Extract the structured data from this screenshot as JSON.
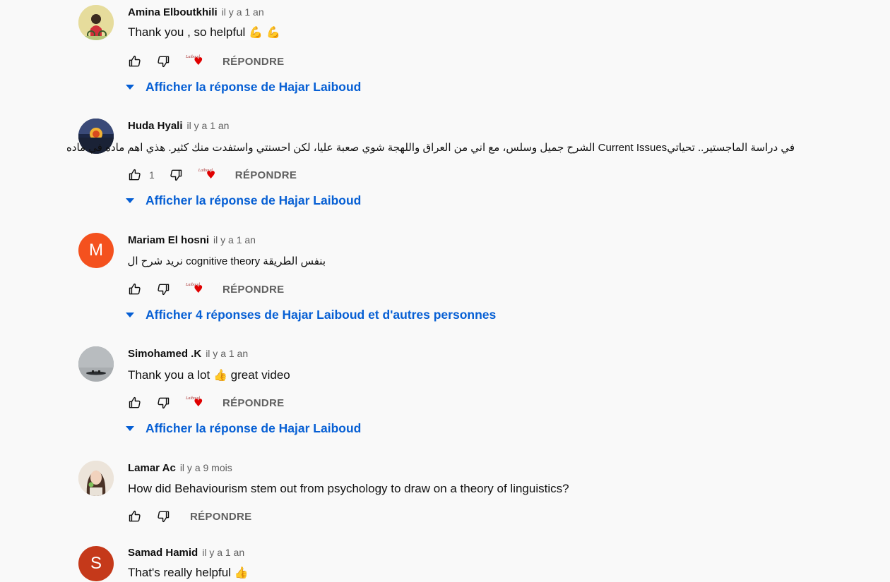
{
  "comments": [
    {
      "author": "Amina Elboutkhili",
      "time": "il y a 1 an",
      "text": "Thank you , so helpful",
      "emoji": "💪 💪",
      "like_count": "",
      "reply_label": "RÉPONDRE",
      "creator_heart_label": "Laiboud",
      "show_replies_label": "Afficher la réponse de Hajar Laiboud"
    },
    {
      "author": "Huda Hyali",
      "time": "il y a 1 an",
      "text": "في دراسة الماجستير.. تحياتيCurrent Issues الشرح جميل وسلس، مع اني من العراق واللهجة شوي صعبة عليا، لكن احسنتي واستفدت منك كثير. هذي اهم ماده في ماده",
      "like_count": "1",
      "reply_label": "RÉPONDRE",
      "creator_heart_label": "Laiboud",
      "show_replies_label": "Afficher la réponse de Hajar Laiboud"
    },
    {
      "author": "Mariam El hosni",
      "time": "il y a 1 an",
      "avatar_letter": "M",
      "text": "بنفس الطريقة cognitive theory نريد شرح ال",
      "like_count": "",
      "reply_label": "RÉPONDRE",
      "creator_heart_label": "Laiboud",
      "show_replies_label": "Afficher 4 réponses de Hajar Laiboud et d'autres personnes"
    },
    {
      "author": "Simohamed .K",
      "time": "il y a 1 an",
      "text_before": "Thank you a lot",
      "emoji": "👍",
      "text_after": "great video",
      "like_count": "",
      "reply_label": "RÉPONDRE",
      "creator_heart_label": "Laiboud",
      "show_replies_label": "Afficher la réponse de Hajar Laiboud"
    },
    {
      "author": "Lamar Ac",
      "time": "il y a 9 mois",
      "text": "How did Behaviourism stem out from psychology to draw on a theory of linguistics?",
      "like_count": "",
      "reply_label": "RÉPONDRE"
    },
    {
      "author": "Samad Hamid",
      "time": "il y a 1 an",
      "avatar_letter": "S",
      "text": "That's really helpful",
      "emoji": "👍"
    }
  ],
  "colors": {
    "link_blue": "#065fd4",
    "meta_gray": "#606060",
    "avatar_orange": "#f4511e",
    "avatar_red": "#c5391a",
    "heart_red": "#e00000"
  },
  "icons": {
    "like": "thumbs-up-icon",
    "dislike": "thumbs-down-icon",
    "creator_heart": "creator-heart-icon",
    "expand": "caret-down-icon"
  }
}
